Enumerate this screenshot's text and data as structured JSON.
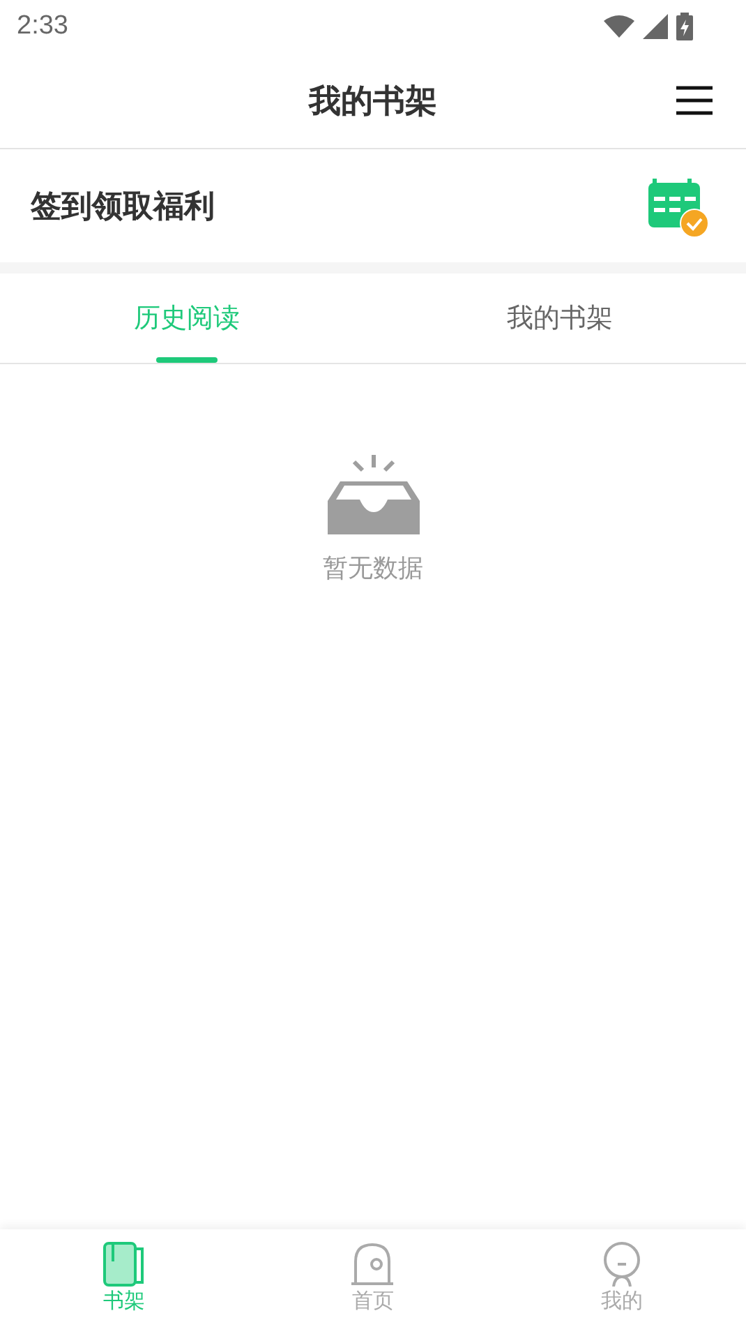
{
  "status_bar": {
    "time": "2:33"
  },
  "header": {
    "title": "我的书架"
  },
  "signin": {
    "label": "签到领取福利"
  },
  "tabs": [
    {
      "label": "历史阅读",
      "selected": true
    },
    {
      "label": "我的书架",
      "selected": false
    }
  ],
  "empty_state": {
    "message": "暂无数据"
  },
  "bottom_nav": [
    {
      "label": "书架",
      "kind": "book",
      "selected": true
    },
    {
      "label": "首页",
      "kind": "home",
      "selected": false
    },
    {
      "label": "我的",
      "kind": "person",
      "selected": false
    }
  ]
}
